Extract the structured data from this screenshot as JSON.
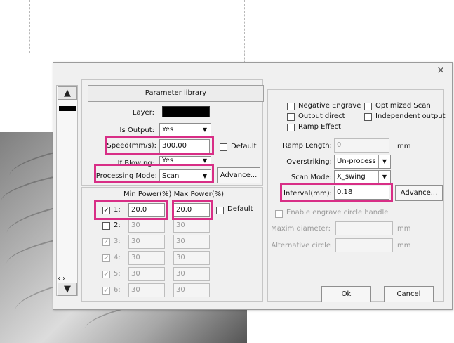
{
  "window": {
    "close_glyph": "×"
  },
  "left": {
    "library_label": "Parameter library",
    "layer_label": "Layer:",
    "is_output_label": "Is Output:",
    "is_output_value": "Yes",
    "speed_label": "Speed(mm/s):",
    "speed_value": "300.00",
    "default_label": "Default",
    "if_blowing_label": "If Blowing:",
    "if_blowing_value": "Yes",
    "processing_mode_label": "Processing Mode:",
    "processing_mode_value": "Scan",
    "advance_label": "Advance...",
    "power_header": "Min Power(%) Max Power(%)",
    "power_default_label": "Default",
    "power_rows": [
      {
        "label": "1:",
        "min": "20.0",
        "max": "20.0",
        "checked": "✓"
      },
      {
        "label": "2:",
        "min": "30",
        "max": "30",
        "checked": ""
      },
      {
        "label": "3:",
        "min": "30",
        "max": "30",
        "checked": "✓"
      },
      {
        "label": "4:",
        "min": "30",
        "max": "30",
        "checked": "✓"
      },
      {
        "label": "5:",
        "min": "30",
        "max": "30",
        "checked": "✓"
      },
      {
        "label": "6:",
        "min": "30",
        "max": "30",
        "checked": "✓"
      }
    ]
  },
  "right": {
    "negative_engrave": "Negative Engrave",
    "optimized_scan": "Optimized Scan",
    "output_direct": "Output direct",
    "independent_output": "Independent output",
    "ramp_effect": "Ramp Effect",
    "ramp_length_label": "Ramp Length:",
    "ramp_length_value": "0",
    "ramp_length_unit": "mm",
    "overstriking_label": "Overstriking:",
    "overstriking_value": "Un-process",
    "scan_mode_label": "Scan Mode:",
    "scan_mode_value": "X_swing",
    "interval_label": "Interval(mm):",
    "interval_value": "0.18",
    "advance_label": "Advance...",
    "circle_handle": "Enable engrave circle handle",
    "maxim_diameter": "Maxim diameter:",
    "alternative_circle": "Alternative circle",
    "unit_mm": "mm",
    "ok_label": "Ok",
    "cancel_label": "Cancel"
  },
  "colors": {
    "highlight": "#d82e86"
  }
}
